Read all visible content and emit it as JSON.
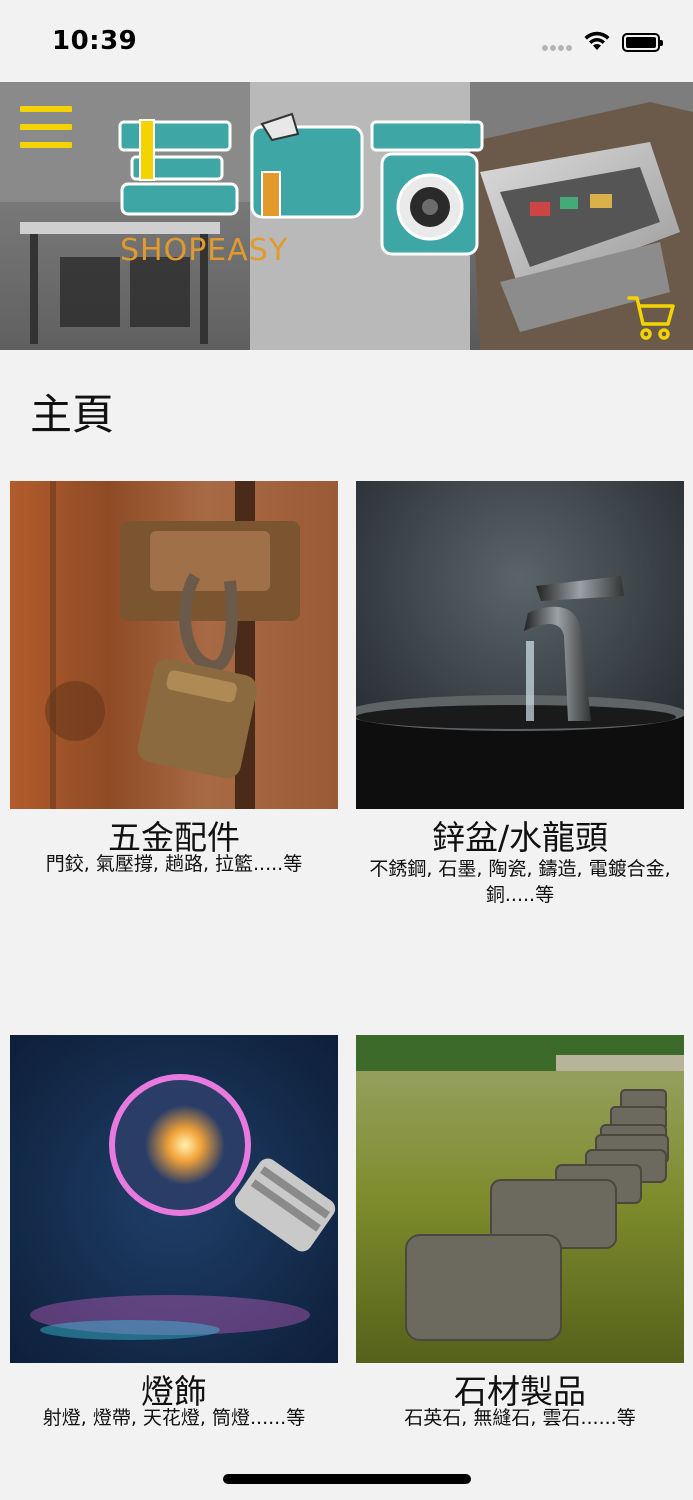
{
  "status_bar": {
    "time": "10:39"
  },
  "header": {
    "logo_chinese": "裝修寶",
    "logo_english": "SHOPEASY",
    "menu_icon": "hamburger-menu-icon",
    "cart_icon": "cart-icon",
    "accent_color": "#f4d400"
  },
  "page": {
    "title": "主頁"
  },
  "categories": [
    {
      "name": "五金配件",
      "description": "門鉸, 氣壓撐, 趟路, 拉籃.....等",
      "image": "padlock-photo"
    },
    {
      "name": "鋅盆/水龍頭",
      "description": "不銹鋼, 石墨, 陶瓷, 鑄造, 電鍍合金, 銅.....等",
      "image": "faucet-photo"
    },
    {
      "name": "燈飾",
      "description": "射燈, 燈帶, 天花燈, 筒燈......等",
      "image": "light-bulb-photo"
    },
    {
      "name": "石材製品",
      "description": "石英石, 無縫石, 雲石......等",
      "image": "stepping-stones-photo"
    }
  ]
}
